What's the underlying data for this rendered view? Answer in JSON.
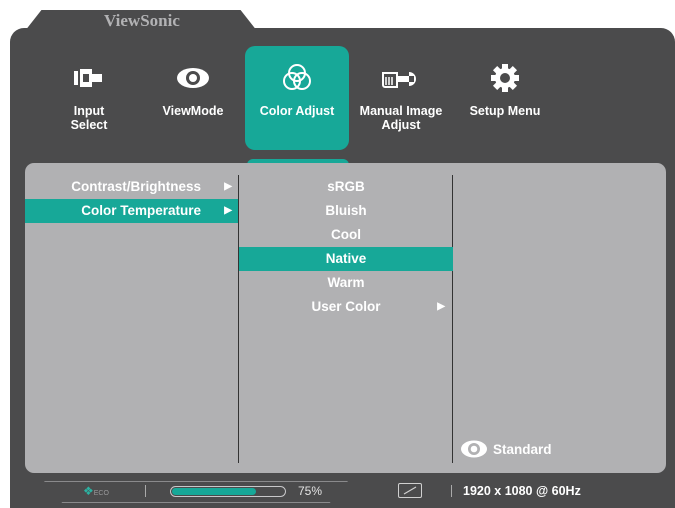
{
  "brand": "ViewSonic",
  "tabs": [
    {
      "label": "Input\nSelect",
      "icon": "input-select-icon"
    },
    {
      "label": "ViewMode",
      "icon": "eye-icon"
    },
    {
      "label": "Color Adjust",
      "icon": "color-circles-icon",
      "active": true
    },
    {
      "label": "Manual Image\nAdjust",
      "icon": "hand-wrench-icon"
    },
    {
      "label": "Setup Menu",
      "icon": "gear-icon"
    }
  ],
  "menu_level1": [
    {
      "label": "Contrast/Brightness",
      "selected": false
    },
    {
      "label": "Color Temperature",
      "selected": true
    }
  ],
  "menu_level2": [
    {
      "label": "sRGB"
    },
    {
      "label": "Bluish"
    },
    {
      "label": "Cool"
    },
    {
      "label": "Native",
      "selected": true
    },
    {
      "label": "Warm"
    },
    {
      "label": "User Color",
      "submenu": true
    }
  ],
  "viewmode": {
    "label": "Standard",
    "icon": "eye-icon"
  },
  "status": {
    "eco_label": "ECO",
    "brightness_percent": 75,
    "brightness_text": "75%",
    "resolution": "1920 x 1080 @ 60Hz"
  },
  "colors": {
    "accent": "#17a898",
    "frame": "#4b4b4c",
    "panel": "#b1b1b3"
  }
}
